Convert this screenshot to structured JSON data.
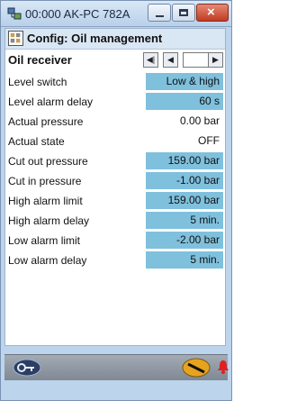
{
  "window": {
    "title": "00:000 AK-PC 782A"
  },
  "header": {
    "title": "Config: Oil management"
  },
  "nav": {
    "title": "Oil receiver"
  },
  "rows": [
    {
      "label": "Level switch",
      "value": "Low & high",
      "editable": true
    },
    {
      "label": "Level alarm delay",
      "value": "60 s",
      "editable": true
    },
    {
      "label": "Actual pressure",
      "value": "0.00 bar",
      "editable": false
    },
    {
      "label": "Actual state",
      "value": "OFF",
      "editable": false
    },
    {
      "label": "Cut out pressure",
      "value": "159.00 bar",
      "editable": true
    },
    {
      "label": "Cut in pressure",
      "value": "-1.00 bar",
      "editable": true
    },
    {
      "label": "High alarm limit",
      "value": "159.00 bar",
      "editable": true
    },
    {
      "label": "High alarm delay",
      "value": "5 min.",
      "editable": true
    },
    {
      "label": "Low alarm limit",
      "value": "-2.00 bar",
      "editable": true
    },
    {
      "label": "Low alarm delay",
      "value": "5 min.",
      "editable": true
    }
  ],
  "icons": {
    "app": "network-icon",
    "config": "config-icon",
    "first": "first-page-icon",
    "prev": "prev-page-icon",
    "next": "next-page-icon",
    "bottom_left": "key-icon",
    "bottom_right": "tool-icon",
    "alarm": "bell-icon"
  },
  "colors": {
    "editable_value_bg": "#7fc0dd",
    "window_bg": "#bcd4ec"
  }
}
